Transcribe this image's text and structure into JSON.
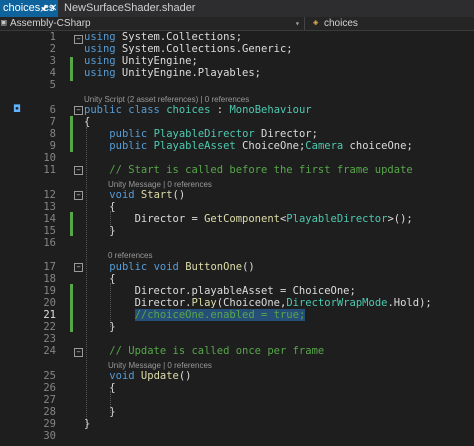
{
  "tabs": [
    {
      "label": "choices.cs",
      "active": true
    },
    {
      "label": "NewSurfaceShader.shader",
      "active": false
    }
  ],
  "navbar": {
    "project": "Assembly-CSharp",
    "member": "choices"
  },
  "codelens": {
    "class": {
      "text": "Unity Script (2 asset references) | 0 references",
      "icon": "unity-icon"
    },
    "start": {
      "text": "Unity Message | 0 references",
      "icon": "unity-icon"
    },
    "buttonone": {
      "text": "0 references"
    },
    "update": {
      "text": "Unity Message | 0 references",
      "icon": "unity-icon"
    }
  },
  "lines": [
    {
      "num": "1",
      "parts": [
        {
          "t": "using",
          "c": "kw"
        },
        {
          "t": " System.Collections;",
          "c": ""
        }
      ]
    },
    {
      "num": "2",
      "parts": [
        {
          "t": "using",
          "c": "kw"
        },
        {
          "t": " System.Collections.Generic;",
          "c": ""
        }
      ]
    },
    {
      "num": "3",
      "parts": [
        {
          "t": "using",
          "c": "kw"
        },
        {
          "t": " UnityEngine;",
          "c": ""
        }
      ]
    },
    {
      "num": "4",
      "parts": [
        {
          "t": "using",
          "c": "kw"
        },
        {
          "t": " UnityEngine.Playables;",
          "c": ""
        }
      ]
    },
    {
      "num": "5",
      "parts": []
    },
    {
      "num": "6",
      "parts": [
        {
          "t": "public",
          "c": "kw"
        },
        {
          "t": " ",
          "c": ""
        },
        {
          "t": "class",
          "c": "kw"
        },
        {
          "t": " ",
          "c": ""
        },
        {
          "t": "choices",
          "c": "ty"
        },
        {
          "t": " : ",
          "c": ""
        },
        {
          "t": "MonoBehaviour",
          "c": "ty"
        }
      ]
    },
    {
      "num": "7",
      "parts": [
        {
          "t": "{",
          "c": ""
        }
      ]
    },
    {
      "num": "8",
      "parts": [
        {
          "t": "    ",
          "c": ""
        },
        {
          "t": "public",
          "c": "kw"
        },
        {
          "t": " ",
          "c": ""
        },
        {
          "t": "PlayableDirector",
          "c": "ty"
        },
        {
          "t": " Director;",
          "c": ""
        }
      ]
    },
    {
      "num": "9",
      "parts": [
        {
          "t": "    ",
          "c": ""
        },
        {
          "t": "public",
          "c": "kw"
        },
        {
          "t": " ",
          "c": ""
        },
        {
          "t": "PlayableAsset",
          "c": "ty"
        },
        {
          "t": " ChoiceOne;",
          "c": ""
        },
        {
          "t": "Camera",
          "c": "ty"
        },
        {
          "t": " choiceOne;",
          "c": ""
        }
      ]
    },
    {
      "num": "10",
      "parts": []
    },
    {
      "num": "11",
      "parts": [
        {
          "t": "    // Start is called before the first frame update",
          "c": "cm"
        }
      ]
    },
    {
      "num": "12",
      "parts": [
        {
          "t": "    ",
          "c": ""
        },
        {
          "t": "void",
          "c": "kw"
        },
        {
          "t": " ",
          "c": ""
        },
        {
          "t": "Start",
          "c": "fn"
        },
        {
          "t": "()",
          "c": ""
        }
      ]
    },
    {
      "num": "13",
      "parts": [
        {
          "t": "    {",
          "c": ""
        }
      ]
    },
    {
      "num": "14",
      "parts": [
        {
          "t": "        Director = ",
          "c": ""
        },
        {
          "t": "GetComponent",
          "c": "fn"
        },
        {
          "t": "<",
          "c": ""
        },
        {
          "t": "PlayableDirector",
          "c": "ty"
        },
        {
          "t": ">();",
          "c": ""
        }
      ]
    },
    {
      "num": "15",
      "parts": [
        {
          "t": "    }",
          "c": ""
        }
      ]
    },
    {
      "num": "16",
      "parts": []
    },
    {
      "num": "17",
      "parts": [
        {
          "t": "    ",
          "c": ""
        },
        {
          "t": "public",
          "c": "kw"
        },
        {
          "t": " ",
          "c": ""
        },
        {
          "t": "void",
          "c": "kw"
        },
        {
          "t": " ",
          "c": ""
        },
        {
          "t": "ButtonOne",
          "c": "fn"
        },
        {
          "t": "()",
          "c": ""
        }
      ]
    },
    {
      "num": "18",
      "parts": [
        {
          "t": "    {",
          "c": ""
        }
      ]
    },
    {
      "num": "19",
      "parts": [
        {
          "t": "        Director.playableAsset = ChoiceOne;",
          "c": ""
        }
      ]
    },
    {
      "num": "20",
      "parts": [
        {
          "t": "        Director.",
          "c": ""
        },
        {
          "t": "Play",
          "c": "fn"
        },
        {
          "t": "(ChoiceOne,",
          "c": ""
        },
        {
          "t": "DirectorWrapMode",
          "c": "ty"
        },
        {
          "t": ".Hold);",
          "c": ""
        }
      ]
    },
    {
      "num": "21",
      "parts": [
        {
          "t": "        ",
          "c": ""
        },
        {
          "t": "//choiceOne.enabled = true;",
          "c": "cm sel"
        }
      ]
    },
    {
      "num": "22",
      "parts": [
        {
          "t": "    }",
          "c": ""
        }
      ]
    },
    {
      "num": "23",
      "parts": []
    },
    {
      "num": "24",
      "parts": [
        {
          "t": "    // Update is called once per frame",
          "c": "cm"
        }
      ]
    },
    {
      "num": "25",
      "parts": [
        {
          "t": "    ",
          "c": ""
        },
        {
          "t": "void",
          "c": "kw"
        },
        {
          "t": " ",
          "c": ""
        },
        {
          "t": "Update",
          "c": "fn"
        },
        {
          "t": "()",
          "c": ""
        }
      ]
    },
    {
      "num": "26",
      "parts": [
        {
          "t": "    {",
          "c": ""
        }
      ]
    },
    {
      "num": "27",
      "parts": []
    },
    {
      "num": "28",
      "parts": [
        {
          "t": "    }",
          "c": ""
        }
      ]
    },
    {
      "num": "29",
      "parts": [
        {
          "t": "}",
          "c": ""
        }
      ]
    },
    {
      "num": "30",
      "parts": []
    }
  ],
  "current_line": "21",
  "colors": {
    "keyword": "#569cd6",
    "type": "#4ec9b0",
    "method": "#dcdcaa",
    "comment": "#57a64a",
    "selection": "#264f78",
    "active_tab": "#0e639c"
  }
}
